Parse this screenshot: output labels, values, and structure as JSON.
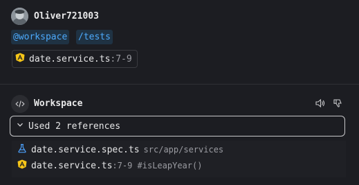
{
  "user": {
    "name": "Oliver721003",
    "chips": [
      "@workspace",
      "/tests"
    ],
    "attachment": {
      "file": "date.service.ts",
      "lines": ":7-9",
      "icon": "angular-icon"
    }
  },
  "response": {
    "agent": "Workspace",
    "actions": [
      "read-aloud-icon",
      "thumbs-down-icon"
    ],
    "references": {
      "toggle_label": "Used 2 references",
      "items": [
        {
          "file": "date.service.spec.ts",
          "detail": "src/app/services",
          "icon": "beaker-icon"
        },
        {
          "file": "date.service.ts",
          "detail": ":7-9 #isLeapYear()",
          "icon": "angular-icon"
        }
      ]
    }
  },
  "colors": {
    "background": "#1c1d22",
    "chip_text": "#4daafc",
    "chip_bg": "#1f3243",
    "angular_yellow": "#f5c518",
    "beaker_blue": "#4da3ff"
  }
}
